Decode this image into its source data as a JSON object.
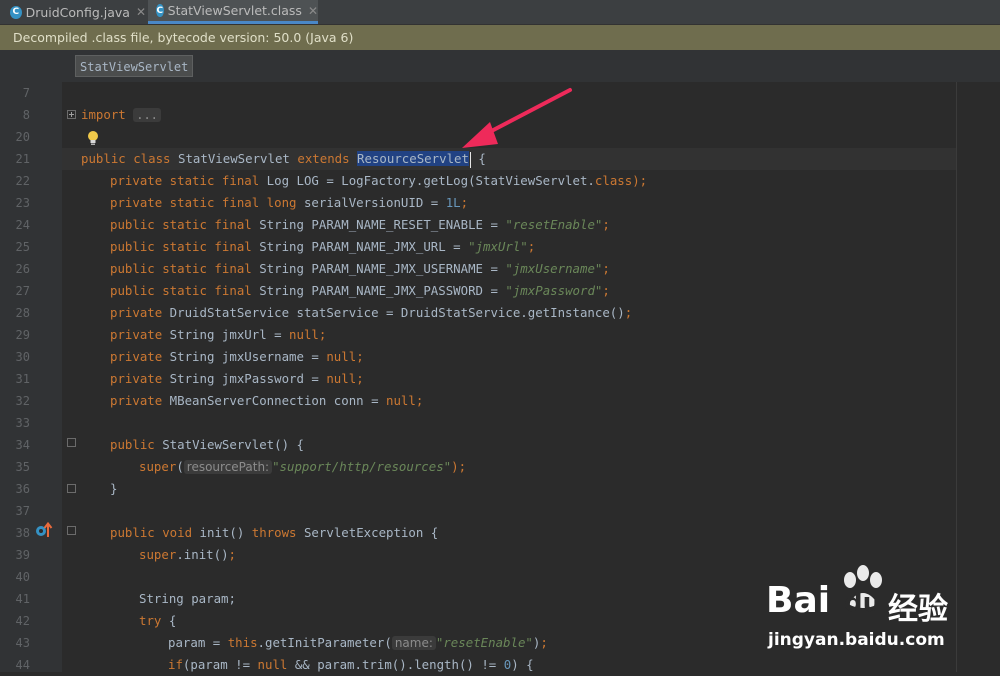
{
  "tabs": [
    {
      "label": "DruidConfig.java",
      "icon": "java-class-icon",
      "active": false
    },
    {
      "label": "StatViewServlet.class",
      "icon": "java-class-icon",
      "active": true
    }
  ],
  "banner": "Decompiled .class file, bytecode version: 50.0 (Java 6)",
  "breadcrumb": "StatViewServlet",
  "colors": {
    "keyword": "#cc7832",
    "string": "#6a8759",
    "number": "#6897bb",
    "text": "#a9b7c6",
    "selection": "#214283",
    "arrow": "#ee2a5a"
  },
  "gutter": {
    "line_numbers": [
      "7",
      "8",
      "20",
      "21",
      "22",
      "23",
      "24",
      "25",
      "26",
      "27",
      "28",
      "29",
      "30",
      "31",
      "32",
      "33",
      "34",
      "35",
      "36",
      "37",
      "38",
      "39",
      "40",
      "41",
      "42",
      "43",
      "44"
    ]
  },
  "code": {
    "l8_import": "import",
    "l8_folded": "...",
    "l21_a": "public class",
    "l21_b": " StatViewServlet ",
    "l21_c": "extends",
    "l21_sel": "ResourceServlet",
    "l21_d": " {",
    "l22_a": "private static final",
    "l22_b": " Log LOG = LogFactory.getLog(StatViewServlet.",
    "l22_c": "class",
    "l22_d": ");",
    "l23_a": "private static final long",
    "l23_b": " serialVersionUID = ",
    "l23_num": "1L",
    "l23_c": ";",
    "l24_a": "public static final",
    "l24_b": " String PARAM_NAME_RESET_ENABLE = ",
    "l24_str": "\"resetEnable\"",
    "l24_c": ";",
    "l25_a": "public static final",
    "l25_b": " String PARAM_NAME_JMX_URL = ",
    "l25_str": "\"jmxUrl\"",
    "l25_c": ";",
    "l26_a": "public static final",
    "l26_b": " String PARAM_NAME_JMX_USERNAME = ",
    "l26_str": "\"jmxUsername\"",
    "l26_c": ";",
    "l27_a": "public static final",
    "l27_b": " String PARAM_NAME_JMX_PASSWORD = ",
    "l27_str": "\"jmxPassword\"",
    "l27_c": ";",
    "l28_a": "private",
    "l28_b": " DruidStatService statService = DruidStatService.getInstance()",
    "l28_c": ";",
    "l29_a": "private",
    "l29_b": " String jmxUrl = ",
    "l29_null": "null",
    "l29_c": ";",
    "l30_a": "private",
    "l30_b": " String jmxUsername = ",
    "l30_null": "null",
    "l30_c": ";",
    "l31_a": "private",
    "l31_b": " String jmxPassword = ",
    "l31_null": "null",
    "l31_c": ";",
    "l32_a": "private",
    "l32_b": " MBeanServerConnection conn = ",
    "l32_null": "null",
    "l32_c": ";",
    "l34_a": "public",
    "l34_b": " StatViewServlet() {",
    "l35_a": "super",
    "l35_b": "(",
    "l35_hint": "resourcePath:",
    "l35_str": "\"support/http/resources\"",
    "l35_c": ");",
    "l36": "}",
    "l38_a": "public void",
    "l38_b": " init() ",
    "l38_c": "throws",
    "l38_d": " ServletException {",
    "l39_a": "super",
    "l39_b": ".init()",
    "l39_c": ";",
    "l41": "String param;",
    "l42_a": "try",
    "l42_b": " {",
    "l43_a": "param = ",
    "l43_b": "this",
    "l43_c": ".getInitParameter(",
    "l43_hint": "name:",
    "l43_str": "\"resetEnable\"",
    "l43_d": ")",
    "l43_e": ";",
    "l44_a": "if",
    "l44_b": "(param != ",
    "l44_null": "null",
    "l44_c": " && param.trim().length() != ",
    "l44_num": "0",
    "l44_d": ") {"
  },
  "watermark": {
    "brand": "Bai",
    "brand2": "du",
    "cn": "经验",
    "url": "jingyan.baidu.com"
  }
}
